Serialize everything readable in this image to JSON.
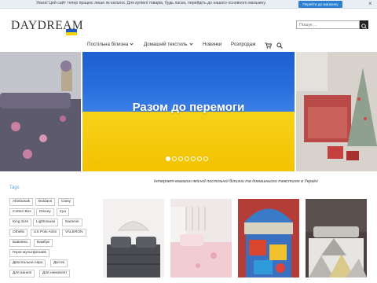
{
  "notice": {
    "text": "Увага! Цей сайт тепер працює лише як каталог. Для купівлі товарів, будь ласка, перейдіть до нашого основного магазину.",
    "button": "Перейти до магазину",
    "close": "×"
  },
  "logo": {
    "text": "DAYDREAM"
  },
  "search": {
    "placeholder": "Пошук ..."
  },
  "nav": {
    "items": [
      {
        "label": "Постільна білизна",
        "has_dropdown": true
      },
      {
        "label": "Домашній текстиль",
        "has_dropdown": true
      },
      {
        "label": "Новинки",
        "has_dropdown": false
      },
      {
        "label": "Розпродаж",
        "has_dropdown": false
      }
    ],
    "icons": [
      "cart-icon",
      "search-icon"
    ]
  },
  "hero": {
    "title": "Разом до перемоги",
    "dots": 7,
    "active_dot": 1,
    "colors": {
      "blue": "#1d5fd0",
      "yellow": "#f6d200"
    }
  },
  "tagline": "Інтернет-магазин якісної постільної білизни та домашнього текстилю в Україні",
  "tags": {
    "title": "Tags",
    "items": [
      "Altinbasak",
      "Buldans",
      "Clasy",
      "Cotton Box",
      "Disney",
      "Irya",
      "King Size",
      "LightHouse",
      "Nazenin",
      "Othello",
      "US Polo Assn",
      "VALERON",
      "Бавовна",
      "Бамбук",
      "Герої мультфільмів",
      "Двоспальне євро",
      "Дитячі",
      "Для ванної",
      "Для немовлят"
    ]
  },
  "products": [
    "product-1",
    "product-2",
    "product-3",
    "product-4"
  ],
  "colors": {
    "accent": "#2d7fd3",
    "tags_title": "#5aa0d6"
  }
}
